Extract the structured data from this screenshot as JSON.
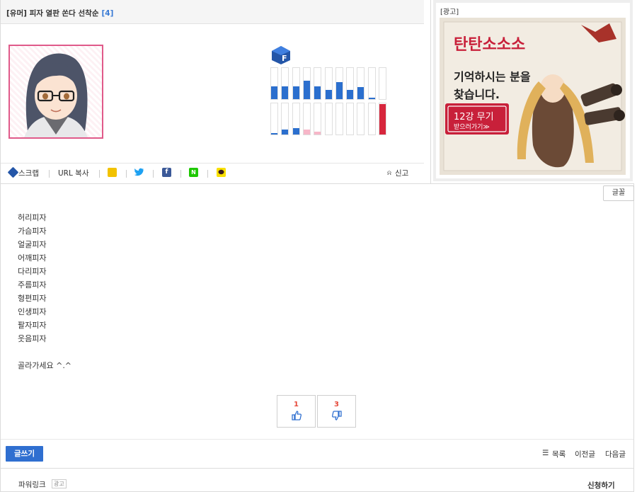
{
  "article": {
    "title": "[유머] 피자 열판 쏜다 선착순",
    "comment_count": "[4]"
  },
  "stats": {
    "icon": "blue-cube-f-icon",
    "top_row": [
      0.42,
      0.42,
      0.4,
      0.6,
      0.4,
      0.3,
      0.55,
      0.3,
      0.38,
      0.05,
      0.0
    ],
    "bottom_row": [
      0.04,
      0.15,
      0.2,
      0.15,
      0.1,
      0.0,
      0.0,
      0.0,
      0.0,
      0.0,
      0.97
    ],
    "colors": {
      "top": "#2b6fce",
      "bottom_blue": "#2b6fce",
      "bottom_pink": "#f7b6c8",
      "bottom_red": "#d7263d"
    }
  },
  "share": {
    "scrap_label": "스크랩",
    "url_copy_label": "URL 복사",
    "report_label": "신고",
    "icons": [
      "kakaostory-icon",
      "twitter-icon",
      "facebook-icon",
      "naver-icon",
      "kakaotalk-icon"
    ]
  },
  "ad": {
    "label": "[광고]",
    "headline": "탄탄소소소",
    "subtext_line1": "기억하시는 분을",
    "subtext_line2": "찾습니다.",
    "badge_main": "12강 무기",
    "badge_sub": "받으러가기≫"
  },
  "content": {
    "font_button": "글꼴",
    "lines": [
      "허리피자",
      "가슴피자",
      "얼굴피자",
      "어깨피자",
      "다리피자",
      "주름피자",
      "형편피자",
      "인생피자",
      "팔자피자",
      "웃음피자",
      "",
      "골라가세요 ^.^"
    ],
    "votes": {
      "up": "1",
      "down": "3"
    },
    "write_button": "글쓰기",
    "nav": {
      "list": "목록",
      "prev": "이전글",
      "next": "다음글"
    }
  },
  "powerlink": {
    "title": "파워링크",
    "badge": "광고",
    "apply": "신청하기"
  }
}
